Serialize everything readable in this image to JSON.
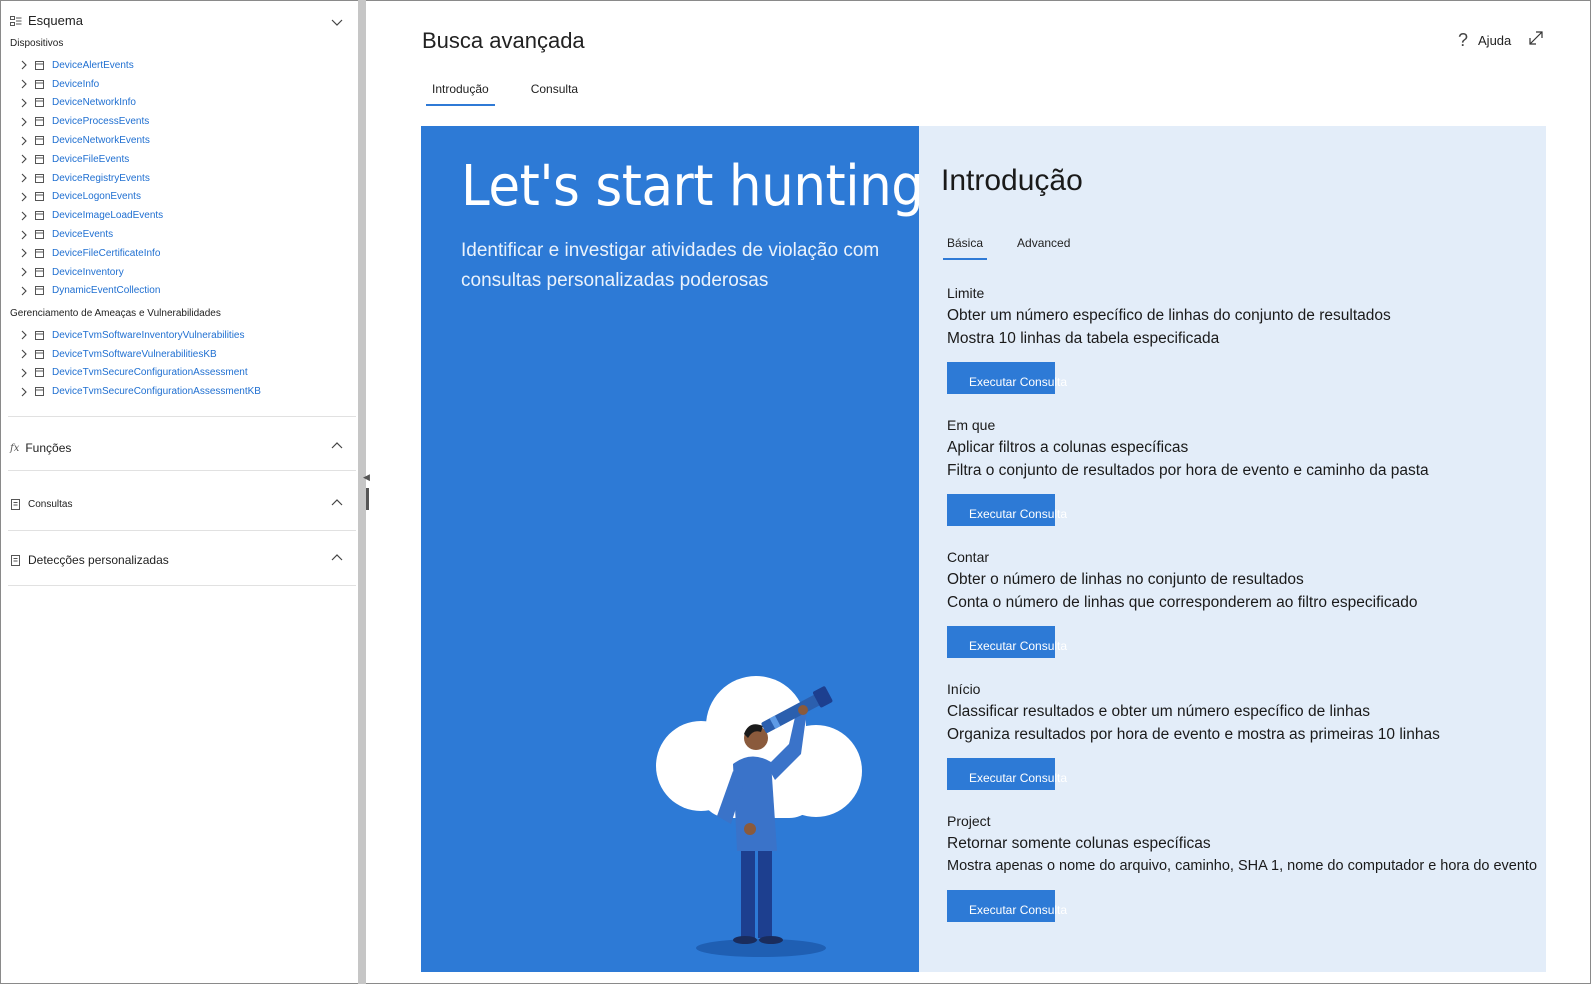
{
  "sidebar": {
    "schema_label": "Esquema",
    "devices_label": "Dispositivos",
    "device_tables": [
      "DeviceAlertEvents",
      "DeviceInfo",
      "DeviceNetworkInfo",
      "DeviceProcessEvents",
      "DeviceNetworkEvents",
      "DeviceFileEvents",
      "DeviceRegistryEvents",
      "DeviceLogonEvents",
      "DeviceImageLoadEvents",
      "DeviceEvents",
      "DeviceFileCertificateInfo",
      "DeviceInventory",
      "DynamicEventCollection"
    ],
    "tvm_label": "Gerenciamento de Ameaças e Vulnerabilidades",
    "tvm_tables": [
      "DeviceTvmSoftwareInventoryVulnerabilities",
      "DeviceTvmSoftwareVulnerabilitiesKB",
      "DeviceTvmSecureConfigurationAssessment",
      "DeviceTvmSecureConfigurationAssessmentKB"
    ],
    "functions_label": "Funções",
    "functions_icon_text": "fx",
    "queries_label": "Consultas",
    "detections_label": "Detecções personalizadas"
  },
  "header": {
    "title": "Busca avançada",
    "help_label": "Ajuda",
    "help_icon_text": "?"
  },
  "tabs": [
    "Introdução",
    "Consulta"
  ],
  "hero": {
    "title": "Let's start hunting",
    "subtitle": "Identificar e investigar atividades de violação com consultas personalizadas poderosas"
  },
  "panel": {
    "title": "Introdução",
    "subtabs": [
      "Básica",
      "Advanced"
    ],
    "run_label": "Executar Consulta",
    "examples": [
      {
        "name": "Limite",
        "summary": "Obter um número específico de linhas do conjunto de resultados",
        "detail": "Mostra 10 linhas da tabela especificada"
      },
      {
        "name": "Em que",
        "summary": "Aplicar filtros a colunas específicas",
        "detail": "Filtra o conjunto de resultados por hora de evento e caminho da pasta"
      },
      {
        "name": "Contar",
        "summary": "Obter o número de linhas no conjunto de resultados",
        "detail": "Conta o número de linhas que corresponderem ao filtro especificado"
      },
      {
        "name": "Início",
        "summary": "Classificar resultados e obter um número específico de linhas",
        "detail": "Organiza resultados por hora de evento e mostra as primeiras 10 linhas"
      },
      {
        "name": "Project",
        "summary": "Retornar somente colunas específicas",
        "detail": "Mostra apenas o nome do arquivo, caminho, SHA 1, nome do computador e hora do evento"
      }
    ]
  },
  "colors": {
    "accent": "#2d7ad6",
    "link": "#1f6fd1",
    "panel_bg": "#e3edf9",
    "splitter": "#c6c6c6"
  },
  "icons": [
    "schema-icon",
    "chevron-down-icon",
    "chevron-right-icon",
    "table-icon",
    "function-icon",
    "queries-icon",
    "detections-icon",
    "chevron-up-icon",
    "help-icon",
    "expand-icon"
  ]
}
